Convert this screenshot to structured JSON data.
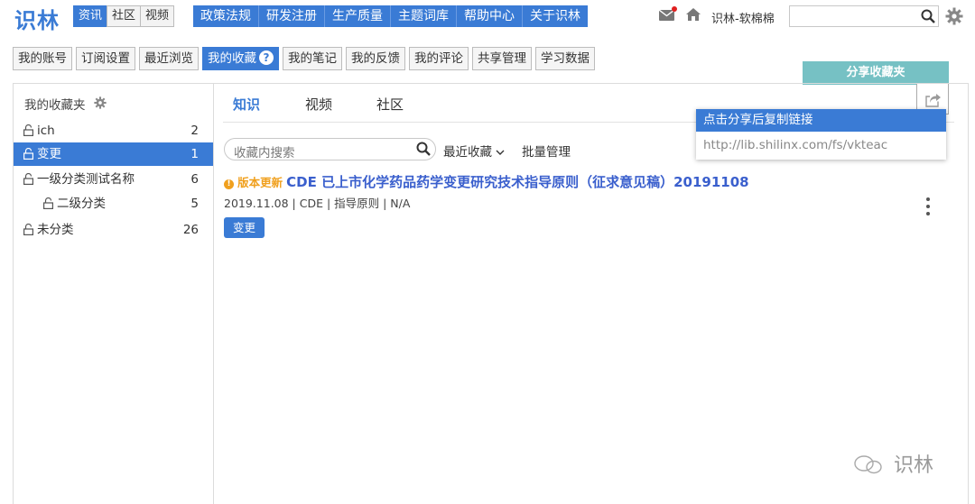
{
  "header": {
    "logo": "识林",
    "segments": [
      {
        "label": "资讯",
        "active": true
      },
      {
        "label": "社区",
        "active": false
      },
      {
        "label": "视频",
        "active": false
      }
    ],
    "nav": [
      "政策法规",
      "研发注册",
      "生产质量",
      "主题词库",
      "帮助中心",
      "关于识林"
    ],
    "username": "识林-软棉棉",
    "search_value": ""
  },
  "subtabs": [
    {
      "label": "我的账号",
      "active": false
    },
    {
      "label": "订阅设置",
      "active": false
    },
    {
      "label": "最近浏览",
      "active": false
    },
    {
      "label": "我的收藏",
      "active": true
    },
    {
      "label": "我的笔记",
      "active": false
    },
    {
      "label": "我的反馈",
      "active": false
    },
    {
      "label": "我的评论",
      "active": false
    },
    {
      "label": "共享管理",
      "active": false
    },
    {
      "label": "学习数据",
      "active": false
    }
  ],
  "share_button": "分享收藏夹",
  "sidebar": {
    "title": "我的收藏夹",
    "items": [
      {
        "label": "ich",
        "count": "2",
        "active": false,
        "level": 1
      },
      {
        "label": "变更",
        "count": "1",
        "active": true,
        "level": 1
      },
      {
        "label": "一级分类测试名称",
        "count": "6",
        "active": false,
        "level": 1
      },
      {
        "label": "二级分类",
        "count": "5",
        "active": false,
        "level": 2
      },
      {
        "label": "未分类",
        "count": "26",
        "active": false,
        "level": 1
      }
    ]
  },
  "main": {
    "tabs": [
      {
        "label": "知识",
        "active": true
      },
      {
        "label": "视频",
        "active": false
      },
      {
        "label": "社区",
        "active": false
      }
    ],
    "search_placeholder": "收藏内搜索",
    "sort_label": "最近收藏",
    "batch_label": "批量管理",
    "item": {
      "update_label": "版本更新",
      "title": "CDE 已上市化学药品药学变更研究技术指导原则（征求意见稿）20191108",
      "meta": "2019.11.08 | CDE | 指导原则 | N/A",
      "tag": "变更"
    }
  },
  "popup": {
    "header": "点击分享后复制链接",
    "link": "http://lib.shilinx.com/fs/vkteac"
  },
  "watermark": "识林",
  "colors": {
    "accent": "#3a7bd5",
    "share": "#76c1c4",
    "update": "#f0a01e"
  }
}
